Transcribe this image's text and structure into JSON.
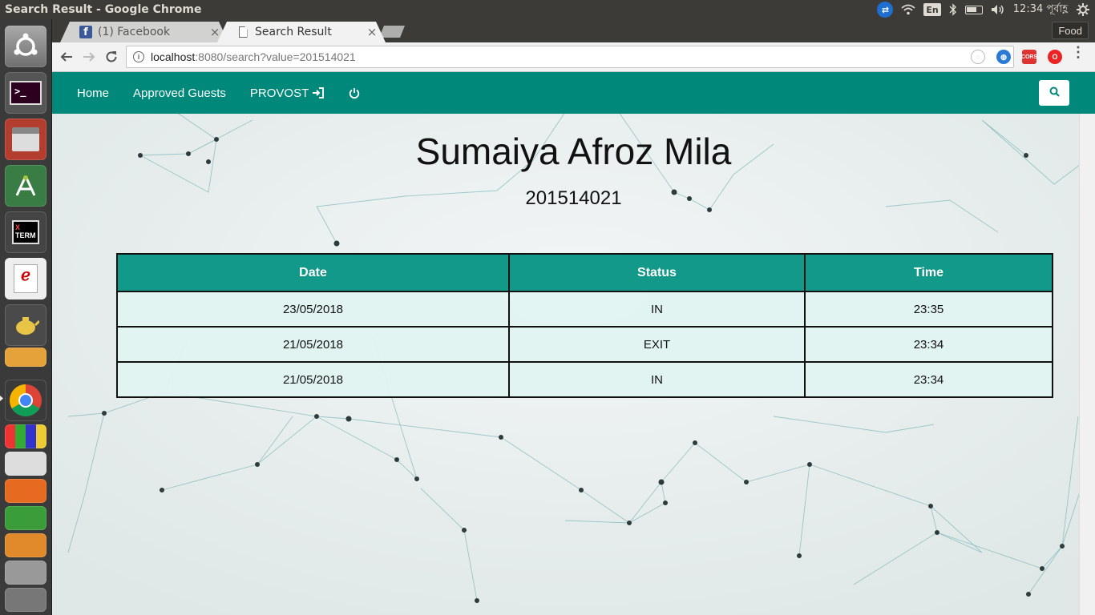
{
  "system": {
    "window_title": "Search Result - Google Chrome",
    "clock": "12:34 পূর্বাহ্ণ",
    "keyboard_layout": "En"
  },
  "launcher": {
    "apps": [
      "ubuntu-dash",
      "terminal",
      "files",
      "android-studio",
      "xterm",
      "document-viewer",
      "gedit-teapot",
      "sublime-text",
      "chrome",
      "libreoffice",
      "text-editor",
      "firefox",
      "calc",
      "amazon"
    ]
  },
  "browser": {
    "tabs": [
      {
        "label": "(1) Facebook",
        "icon": "facebook-icon"
      },
      {
        "label": "Search Result",
        "icon": "page-icon"
      }
    ],
    "profile": "Food",
    "url_host": "localhost",
    "url_rest": ":8080/search?value=201514021"
  },
  "navbar": {
    "home": "Home",
    "approved_guests": "Approved Guests",
    "provost": "PROVOST"
  },
  "profile": {
    "name": "Sumaiya Afroz Mila",
    "id": "201514021"
  },
  "table": {
    "headers": {
      "date": "Date",
      "status": "Status",
      "time": "Time"
    },
    "rows": [
      {
        "date": "23/05/2018",
        "status": "IN",
        "time": "23:35"
      },
      {
        "date": "21/05/2018",
        "status": "EXIT",
        "time": "23:34"
      },
      {
        "date": "21/05/2018",
        "status": "IN",
        "time": "23:34"
      }
    ]
  },
  "colors": {
    "navbar": "#00897b",
    "table_header": "#13998a",
    "table_cell": "#e1f4f2"
  }
}
